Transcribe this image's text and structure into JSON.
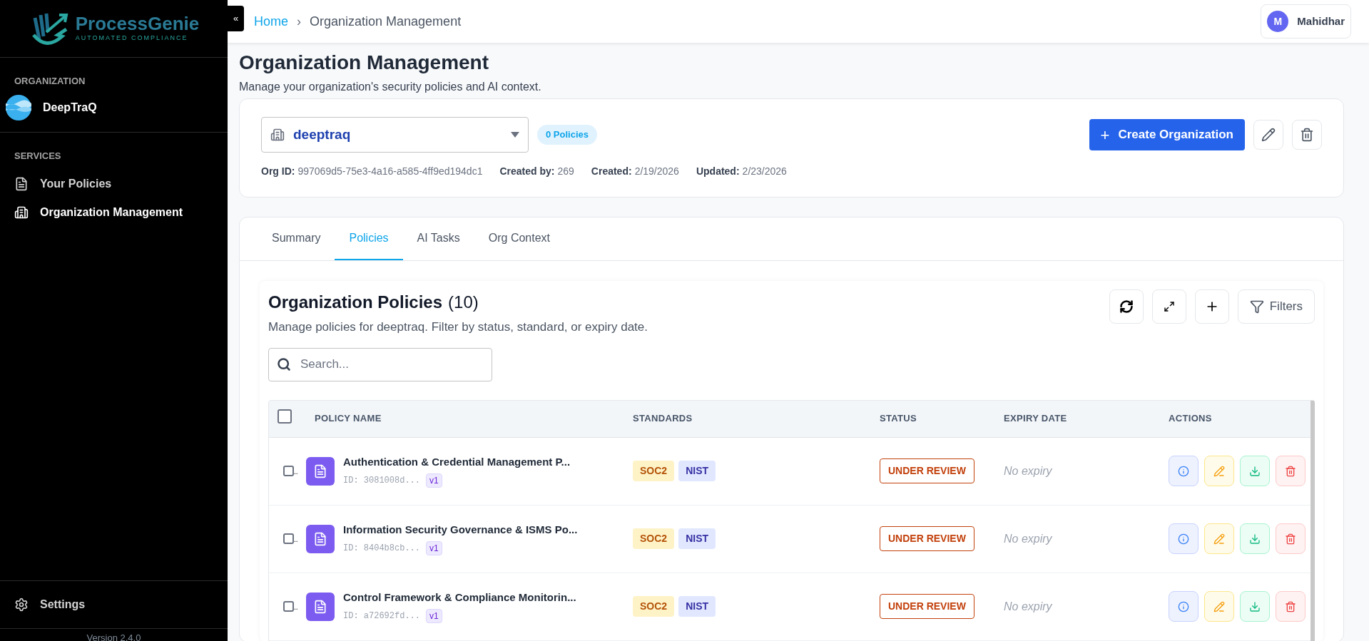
{
  "sidebar": {
    "logo": {
      "name": "ProcessGenie",
      "tagline": "AUTOMATED COMPLIANCE"
    },
    "organization_heading": "ORGANIZATION",
    "organization": "DeepTraQ",
    "services_heading": "SERVICES",
    "items": [
      {
        "label": "Your Policies",
        "kind": "file",
        "selected": false
      },
      {
        "label": "Organization Management",
        "kind": "building",
        "selected": true
      }
    ],
    "settings": "Settings",
    "version": "Version 2.4.0",
    "collapse": "«"
  },
  "header": {
    "breadcrumbs": [
      {
        "label": "Home",
        "link": true
      },
      {
        "label": "Organization Management",
        "link": false
      }
    ],
    "separator": "›",
    "user": {
      "initial": "M",
      "name": "Mahidhar"
    }
  },
  "page": {
    "title": "Organization Management",
    "subtitle": "Manage your organization's security policies and AI context."
  },
  "org_card": {
    "selected_org": "deeptraq",
    "policy_count": "0 Policies",
    "create_button": "Create Organization",
    "create_icon": "+",
    "meta": [
      {
        "label": "Org ID:",
        "value": "997069d5-75e3-4a16-a585-4ff9ed194dc1"
      },
      {
        "label": "Created by:",
        "value": "269"
      },
      {
        "label": "Created:",
        "value": "2/19/2026"
      },
      {
        "label": "Updated:",
        "value": "2/23/2026"
      }
    ]
  },
  "tabs": [
    {
      "label": "Summary",
      "selected": false
    },
    {
      "label": "Policies",
      "selected": true
    },
    {
      "label": "AI Tasks",
      "selected": false
    },
    {
      "label": "Org Context",
      "selected": false
    }
  ],
  "policies": {
    "title": "Organization Policies",
    "count": "(10)",
    "description": "Manage policies for deeptraq. Filter by status, standard, or expiry date.",
    "search_placeholder": "Search...",
    "filters_button": "Filters",
    "columns": [
      "POLICY NAME",
      "STANDARDS",
      "STATUS",
      "EXPIRY DATE",
      "ACTIONS"
    ],
    "select_all_checked": false,
    "rows": [
      {
        "checked": false,
        "checkbox_label": "..",
        "name": "Authentication & Credential Management P...",
        "id": "ID: 3081008d...",
        "version": "v1",
        "standards": [
          {
            "label": "SOC2",
            "kind": "soc2"
          },
          {
            "label": "NIST",
            "kind": "nist"
          }
        ],
        "status": "UNDER REVIEW",
        "expiry": "No expiry"
      },
      {
        "checked": false,
        "checkbox_label": "..",
        "name": "Information Security Governance & ISMS Po...",
        "id": "ID: 8404b8cb...",
        "version": "v1",
        "standards": [
          {
            "label": "SOC2",
            "kind": "soc2"
          },
          {
            "label": "NIST",
            "kind": "nist"
          }
        ],
        "status": "UNDER REVIEW",
        "expiry": "No expiry"
      },
      {
        "checked": false,
        "checkbox_label": "..",
        "name": "Control Framework & Compliance Monitorin...",
        "id": "ID: a72692fd...",
        "version": "v1",
        "standards": [
          {
            "label": "SOC2",
            "kind": "soc2"
          },
          {
            "label": "NIST",
            "kind": "nist"
          }
        ],
        "status": "UNDER REVIEW",
        "expiry": "No expiry"
      }
    ]
  }
}
